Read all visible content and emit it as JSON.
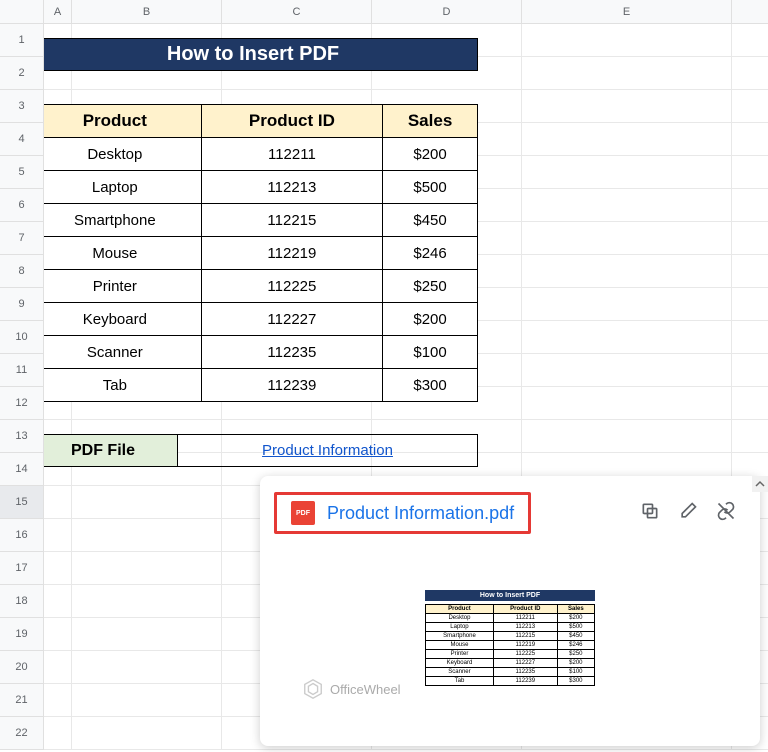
{
  "columns": [
    "A",
    "B",
    "C",
    "D",
    "E"
  ],
  "rowCount": 22,
  "title": "How to Insert PDF",
  "table": {
    "headers": [
      "Product",
      "Product ID",
      "Sales"
    ],
    "rows": [
      [
        "Desktop",
        "112211",
        "$200"
      ],
      [
        "Laptop",
        "112213",
        "$500"
      ],
      [
        "Smartphone",
        "112215",
        "$450"
      ],
      [
        "Mouse",
        "112219",
        "$246"
      ],
      [
        "Printer",
        "112225",
        "$250"
      ],
      [
        "Keyboard",
        "112227",
        "$200"
      ],
      [
        "Scanner",
        "112235",
        "$100"
      ],
      [
        "Tab",
        "112239",
        "$300"
      ]
    ]
  },
  "pdfSection": {
    "label": "PDF File",
    "linkText": "Product Information"
  },
  "popup": {
    "iconLabel": "PDF",
    "fileName": "Product Information.pdf",
    "watermark": "OfficeWheel",
    "previewTitle": "How to Insert PDF",
    "previewHeaders": [
      "Product",
      "Product ID",
      "Sales"
    ],
    "previewRows": [
      [
        "Desktop",
        "112211",
        "$200"
      ],
      [
        "Laptop",
        "112213",
        "$500"
      ],
      [
        "Smartphone",
        "112215",
        "$450"
      ],
      [
        "Mouse",
        "112219",
        "$246"
      ],
      [
        "Printer",
        "112225",
        "$250"
      ],
      [
        "Keyboard",
        "112227",
        "$200"
      ],
      [
        "Scanner",
        "112235",
        "$100"
      ],
      [
        "Tab",
        "112239",
        "$300"
      ]
    ]
  }
}
